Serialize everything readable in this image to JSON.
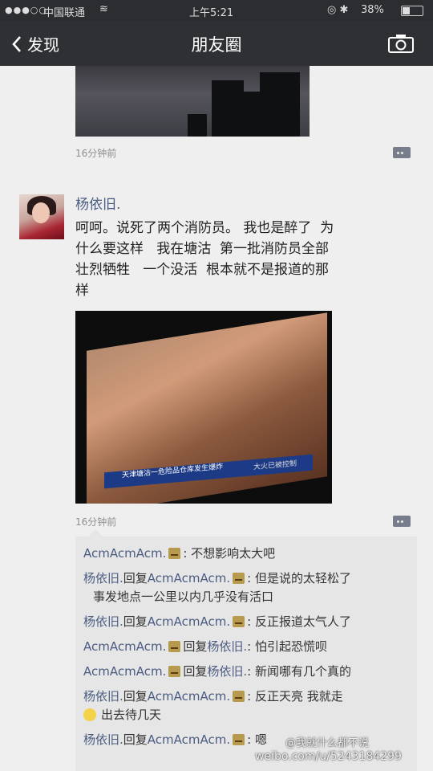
{
  "status_bar": {
    "signal": "●●●○○",
    "carrier": "中国联通",
    "time": "上午5:21",
    "battery": "38%"
  },
  "nav": {
    "back_label": "发现",
    "title": "朋友圈"
  },
  "feed": {
    "prev_post": {
      "time": "16分钟前"
    },
    "post": {
      "user": "杨依旧.",
      "text_lines": [
        "呵呵。说死了两个消防员。 我也是醉了  为",
        "什么要这样   我在塘沽  第一批消防员全部",
        "壮烈牺牲   一个没活  根本就不是报道的那",
        "样"
      ],
      "image_banner": "天津塘沽一危险品仓库发生爆炸",
      "image_banner_sub": "大火已被控制",
      "time": "16分钟前"
    },
    "comments": [
      {
        "name": "AcmAcmAcm.",
        "reply_to": "",
        "text": ": 不想影响太大吧"
      },
      {
        "name": "杨依旧.",
        "reply_to": "AcmAcmAcm.",
        "text": ": 但是说的太轻松了",
        "cont": "事发地点一公里以内几乎没有活口"
      },
      {
        "name": "杨依旧.",
        "reply_to": "AcmAcmAcm.",
        "text": ": 反正报道太气人了"
      },
      {
        "name": "AcmAcmAcm.",
        "reply_to": "杨依旧.",
        "text": ": 怕引起恐慌呗"
      },
      {
        "name": "AcmAcmAcm.",
        "reply_to": "杨依旧.",
        "text": ": 新闻哪有几个真的"
      },
      {
        "name": "杨依旧.",
        "reply_to": "AcmAcmAcm.",
        "text": ": 反正天亮 我就走",
        "cont": "出去待几天"
      },
      {
        "name": "杨依旧.",
        "reply_to": "AcmAcmAcm.",
        "text": ": 嗯"
      }
    ],
    "reply_word": "回复"
  },
  "watermark": {
    "line1": "@我就什么都不说",
    "line2": "weibo.com/u/5243184299"
  }
}
